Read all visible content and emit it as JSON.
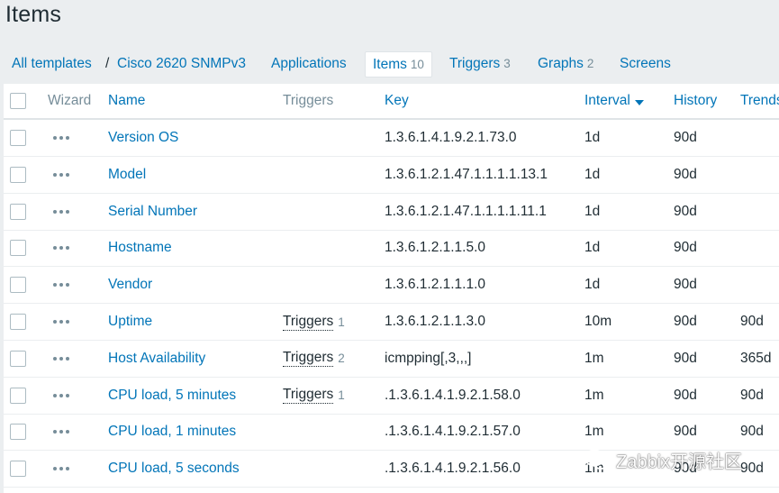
{
  "page": {
    "title": "Items"
  },
  "nav": {
    "breadcrumb_templates": "All templates",
    "breadcrumb_separator": "/",
    "breadcrumb_host": "Cisco 2620 SNMPv3",
    "tabs": [
      {
        "label": "Applications",
        "count": ""
      },
      {
        "label": "Items",
        "count": "10"
      },
      {
        "label": "Triggers",
        "count": "3"
      },
      {
        "label": "Graphs",
        "count": "2"
      },
      {
        "label": "Screens",
        "count": ""
      }
    ]
  },
  "table": {
    "headers": {
      "wizard": "Wizard",
      "name": "Name",
      "triggers": "Triggers",
      "key": "Key",
      "interval": "Interval",
      "history": "History",
      "trends": "Trends"
    },
    "rows": [
      {
        "name": "Version OS",
        "triggers": "",
        "trigger_count": "",
        "key": "1.3.6.1.4.1.9.2.1.73.0",
        "interval": "1d",
        "history": "90d",
        "trends": ""
      },
      {
        "name": "Model",
        "triggers": "",
        "trigger_count": "",
        "key": "1.3.6.1.2.1.47.1.1.1.1.13.1",
        "interval": "1d",
        "history": "90d",
        "trends": ""
      },
      {
        "name": "Serial Number",
        "triggers": "",
        "trigger_count": "",
        "key": "1.3.6.1.2.1.47.1.1.1.1.11.1",
        "interval": "1d",
        "history": "90d",
        "trends": ""
      },
      {
        "name": "Hostname",
        "triggers": "",
        "trigger_count": "",
        "key": "1.3.6.1.2.1.1.5.0",
        "interval": "1d",
        "history": "90d",
        "trends": ""
      },
      {
        "name": "Vendor",
        "triggers": "",
        "trigger_count": "",
        "key": "1.3.6.1.2.1.1.1.0",
        "interval": "1d",
        "history": "90d",
        "trends": ""
      },
      {
        "name": "Uptime",
        "triggers": "Triggers",
        "trigger_count": "1",
        "key": "1.3.6.1.2.1.1.3.0",
        "interval": "10m",
        "history": "90d",
        "trends": "90d"
      },
      {
        "name": "Host Availability",
        "triggers": "Triggers",
        "trigger_count": "2",
        "key": "icmpping[,3,,,]",
        "interval": "1m",
        "history": "90d",
        "trends": "365d"
      },
      {
        "name": "CPU load, 5 minutes",
        "triggers": "Triggers",
        "trigger_count": "1",
        "key": ".1.3.6.1.4.1.9.2.1.58.0",
        "interval": "1m",
        "history": "90d",
        "trends": "90d"
      },
      {
        "name": "CPU load, 1 minutes",
        "triggers": "",
        "trigger_count": "",
        "key": ".1.3.6.1.4.1.9.2.1.57.0",
        "interval": "1m",
        "history": "90d",
        "trends": "90d"
      },
      {
        "name": "CPU load, 5 seconds",
        "triggers": "",
        "trigger_count": "",
        "key": ".1.3.6.1.4.1.9.2.1.56.0",
        "interval": "1m",
        "history": "90d",
        "trends": "90d"
      }
    ]
  },
  "watermark": {
    "text": "Zabbix开源社区",
    "icon": "wechat-icon"
  },
  "colors": {
    "link": "#0275b8",
    "text": "#1f2c33",
    "muted": "#768d99",
    "background": "#ebeef0"
  }
}
